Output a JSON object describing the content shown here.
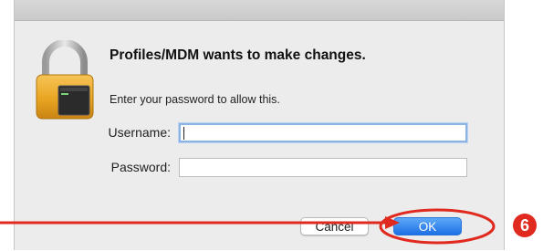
{
  "dialog": {
    "title": "Profiles/MDM wants to make changes.",
    "message": "Enter your password to allow this.",
    "icon": "padlock-icon",
    "username_label": "Username:",
    "username_value": "",
    "password_label": "Password:",
    "password_value": "",
    "cancel_label": "Cancel",
    "ok_label": "OK"
  },
  "annotation": {
    "step_number": "6",
    "color": "#e02a1f",
    "arrow_target": "ok-button"
  },
  "colors": {
    "ok_button": "#1d6fe6",
    "dialog_background": "#ececec",
    "focus_ring": "#8db3e4"
  }
}
